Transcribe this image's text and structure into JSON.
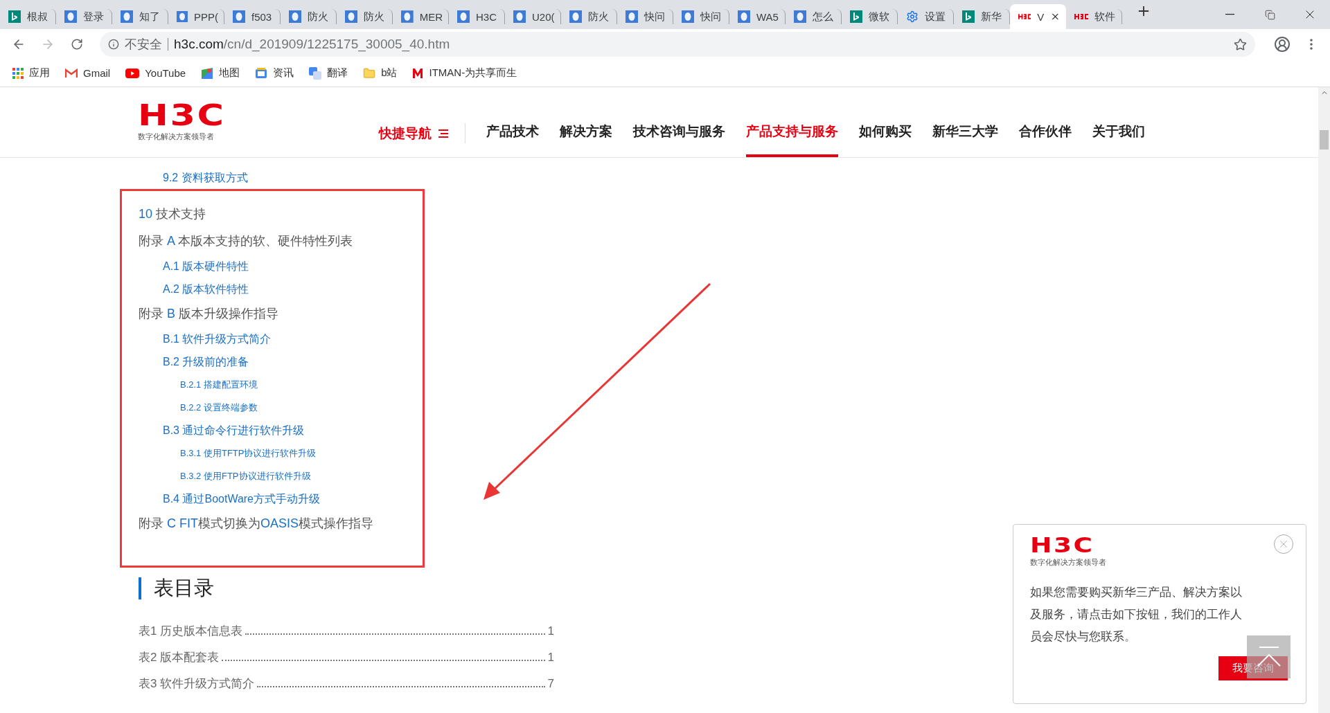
{
  "browser": {
    "tabs": [
      {
        "title": "根叔",
        "kind": "bing",
        "selected": false
      },
      {
        "title": "登录",
        "kind": "doc",
        "selected": false
      },
      {
        "title": "知了",
        "kind": "doc",
        "selected": false
      },
      {
        "title": "PPP(",
        "kind": "doc",
        "selected": false
      },
      {
        "title": "f503",
        "kind": "doc",
        "selected": false
      },
      {
        "title": "防火",
        "kind": "doc",
        "selected": false
      },
      {
        "title": "防火",
        "kind": "doc",
        "selected": false
      },
      {
        "title": "MER",
        "kind": "doc",
        "selected": false
      },
      {
        "title": "H3C",
        "kind": "doc",
        "selected": false
      },
      {
        "title": "U20(",
        "kind": "doc",
        "selected": false
      },
      {
        "title": "防火",
        "kind": "doc",
        "selected": false
      },
      {
        "title": "快问",
        "kind": "doc",
        "selected": false
      },
      {
        "title": "快问",
        "kind": "doc",
        "selected": false
      },
      {
        "title": "WA5",
        "kind": "doc",
        "selected": false
      },
      {
        "title": "怎么",
        "kind": "doc",
        "selected": false
      },
      {
        "title": "微软",
        "kind": "bing",
        "selected": false
      },
      {
        "title": "设置",
        "kind": "gear",
        "selected": false
      },
      {
        "title": "新华",
        "kind": "bing",
        "selected": false
      },
      {
        "title": "V",
        "kind": "h3c",
        "selected": true
      },
      {
        "title": "软件",
        "kind": "h3c",
        "selected": false
      }
    ],
    "address": {
      "security": "不安全",
      "url_host": "h3c.com",
      "url_path": "/cn/d_201909/1225175_30005_40.htm"
    },
    "bookmarks": [
      {
        "label": "应用",
        "kind": "apps"
      },
      {
        "label": "Gmail",
        "kind": "gmail"
      },
      {
        "label": "YouTube",
        "kind": "youtube"
      },
      {
        "label": "地图",
        "kind": "maps"
      },
      {
        "label": "资讯",
        "kind": "news"
      },
      {
        "label": "翻译",
        "kind": "translate"
      },
      {
        "label": "b站",
        "kind": "folder"
      },
      {
        "label": "ITMAN-为共享而生",
        "kind": "m"
      }
    ]
  },
  "header": {
    "logo": {
      "mark": "H3C",
      "tagline": "数字化解决方案领导者"
    },
    "quick_nav": "快捷导航",
    "nav": [
      {
        "label": "产品技术",
        "selected": false
      },
      {
        "label": "解决方案",
        "selected": false
      },
      {
        "label": "技术咨询与服务",
        "selected": false
      },
      {
        "label": "产品支持与服务",
        "selected": true
      },
      {
        "label": "如何购买",
        "selected": false
      },
      {
        "label": "新华三大学",
        "selected": false
      },
      {
        "label": "合作伙伴",
        "selected": false
      },
      {
        "label": "关于我们",
        "selected": false
      }
    ]
  },
  "toc": {
    "cut_entries": [
      {
        "segments": [
          {
            "text": "9.2 资料获取方式",
            "link": true
          }
        ]
      }
    ],
    "entries": [
      {
        "segments": [
          {
            "text": "10",
            "link": true
          },
          {
            "text": " 技术支持",
            "link": false
          }
        ]
      },
      {
        "segments": [
          {
            "text": "附录 ",
            "link": false
          },
          {
            "text": "A",
            "link": true
          },
          {
            "text": " 本版本支持的软、硬件特性列表",
            "link": false
          }
        ],
        "children": [
          {
            "segments": [
              {
                "text": "A.1 版本硬件特性",
                "link": true
              }
            ]
          },
          {
            "segments": [
              {
                "text": "A.2 版本软件特性",
                "link": true
              }
            ]
          }
        ]
      },
      {
        "segments": [
          {
            "text": "附录 ",
            "link": false
          },
          {
            "text": "B",
            "link": true
          },
          {
            "text": " 版本升级操作指导",
            "link": false
          }
        ],
        "children": [
          {
            "segments": [
              {
                "text": "B.1 软件升级方式简介",
                "link": true
              }
            ]
          },
          {
            "segments": [
              {
                "text": "B.2 升级前的准备",
                "link": true
              }
            ],
            "children": [
              {
                "segments": [
                  {
                    "text": "B.2.1 搭建配置环境",
                    "link": true
                  }
                ]
              },
              {
                "segments": [
                  {
                    "text": "B.2.2 设置终端参数",
                    "link": true
                  }
                ]
              }
            ]
          },
          {
            "segments": [
              {
                "text": "B.3 通过命令行进行软件升级",
                "link": true
              }
            ],
            "children": [
              {
                "segments": [
                  {
                    "text": "B.3.1 使用TFTP协议进行软件升级",
                    "link": true
                  }
                ]
              },
              {
                "segments": [
                  {
                    "text": "B.3.2 使用FTP协议进行软件升级",
                    "link": true
                  }
                ]
              }
            ]
          },
          {
            "segments": [
              {
                "text": "B.4 通过BootWare方式手动升级",
                "link": true
              }
            ]
          }
        ]
      },
      {
        "segments": [
          {
            "text": "附录 ",
            "link": false
          },
          {
            "text": "C FIT",
            "link": true
          },
          {
            "text": "模式切换为",
            "link": false
          },
          {
            "text": "OASIS",
            "link": true
          },
          {
            "text": "模式操作指导",
            "link": false
          }
        ]
      }
    ]
  },
  "table_list": {
    "heading": "表目录",
    "items": [
      {
        "label": "表1 历史版本信息表",
        "page": "1"
      },
      {
        "label": "表2 版本配套表",
        "page": "1"
      },
      {
        "label": "表3 软件升级方式简介",
        "page": "7"
      }
    ]
  },
  "popup": {
    "logo": {
      "mark": "H3C",
      "tagline": "数字化解决方案领导者"
    },
    "message": "如果您需要购买新华三产品、解决方案以及服务，请点击如下按钮，我们的工作人员会尽快与您联系。",
    "button": "我要咨询"
  }
}
